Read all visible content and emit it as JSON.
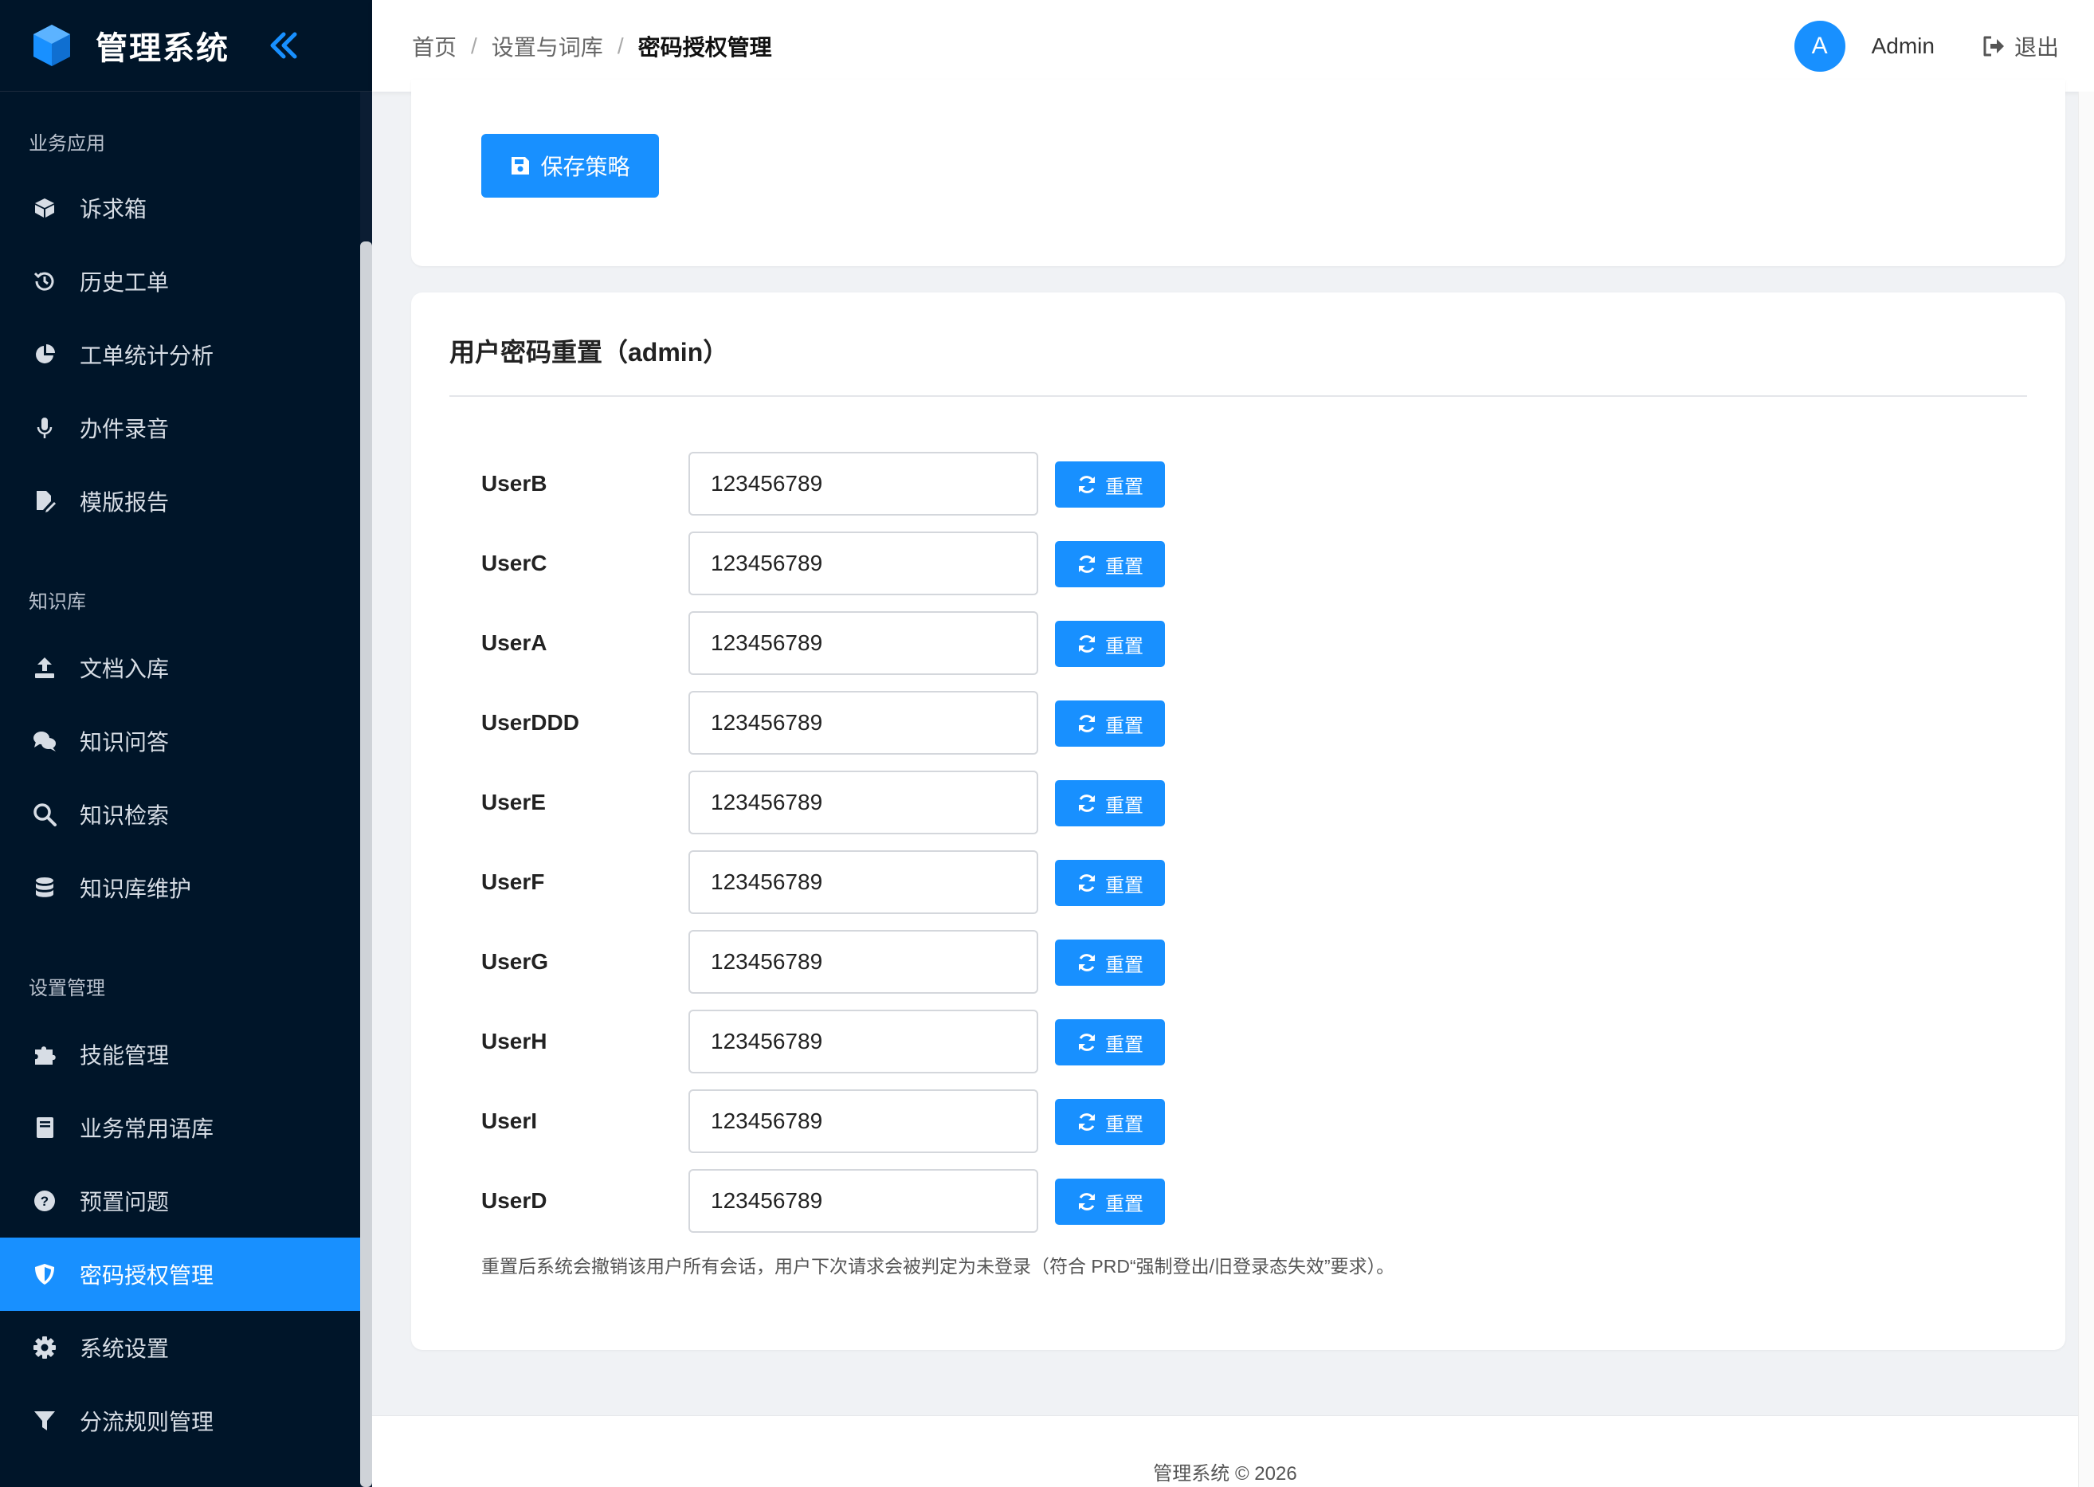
{
  "app": {
    "name": "管理系统"
  },
  "colors": {
    "sidebar_bg": "#001529",
    "accent": "#1890ff",
    "page_bg": "#f0f2f5"
  },
  "sidebar": {
    "groups": [
      {
        "title": "业务应用",
        "items": [
          {
            "label": "诉求箱",
            "icon": "inbox-box-icon"
          },
          {
            "label": "历史工单",
            "icon": "history-icon"
          },
          {
            "label": "工单统计分析",
            "icon": "pie-chart-icon"
          },
          {
            "label": "办件录音",
            "icon": "microphone-icon"
          },
          {
            "label": "模版报告",
            "icon": "file-edit-icon"
          }
        ]
      },
      {
        "title": "知识库",
        "items": [
          {
            "label": "文档入库",
            "icon": "upload-icon"
          },
          {
            "label": "知识问答",
            "icon": "chat-bubbles-icon"
          },
          {
            "label": "知识检索",
            "icon": "search-icon"
          },
          {
            "label": "知识库维护",
            "icon": "database-icon"
          }
        ]
      },
      {
        "title": "设置管理",
        "items": [
          {
            "label": "技能管理",
            "icon": "puzzle-icon"
          },
          {
            "label": "业务常用语库",
            "icon": "book-icon"
          },
          {
            "label": "预置问题",
            "icon": "question-circle-icon"
          },
          {
            "label": "密码授权管理",
            "icon": "shield-icon",
            "active": true
          },
          {
            "label": "系统设置",
            "icon": "gear-icon"
          },
          {
            "label": "分流规则管理",
            "icon": "filter-icon"
          }
        ]
      }
    ]
  },
  "header": {
    "breadcrumb": [
      "首页",
      "设置与词库",
      "密码授权管理"
    ],
    "avatar_letter": "A",
    "username": "Admin",
    "logout_label": "退出"
  },
  "policy": {
    "save_label": "保存策略"
  },
  "reset_section": {
    "title": "用户密码重置（admin）",
    "reset_label": "重置",
    "users": [
      {
        "name": "UserB",
        "password": "123456789"
      },
      {
        "name": "UserC",
        "password": "123456789"
      },
      {
        "name": "UserA",
        "password": "123456789"
      },
      {
        "name": "UserDDD",
        "password": "123456789"
      },
      {
        "name": "UserE",
        "password": "123456789"
      },
      {
        "name": "UserF",
        "password": "123456789"
      },
      {
        "name": "UserG",
        "password": "123456789"
      },
      {
        "name": "UserH",
        "password": "123456789"
      },
      {
        "name": "UserI",
        "password": "123456789"
      },
      {
        "name": "UserD",
        "password": "123456789"
      }
    ],
    "note": "重置后系统会撤销该用户所有会话，用户下次请求会被判定为未登录（符合 PRD“强制登出/旧登录态失效”要求）。"
  },
  "footer": {
    "text": "管理系统 © 2026"
  }
}
